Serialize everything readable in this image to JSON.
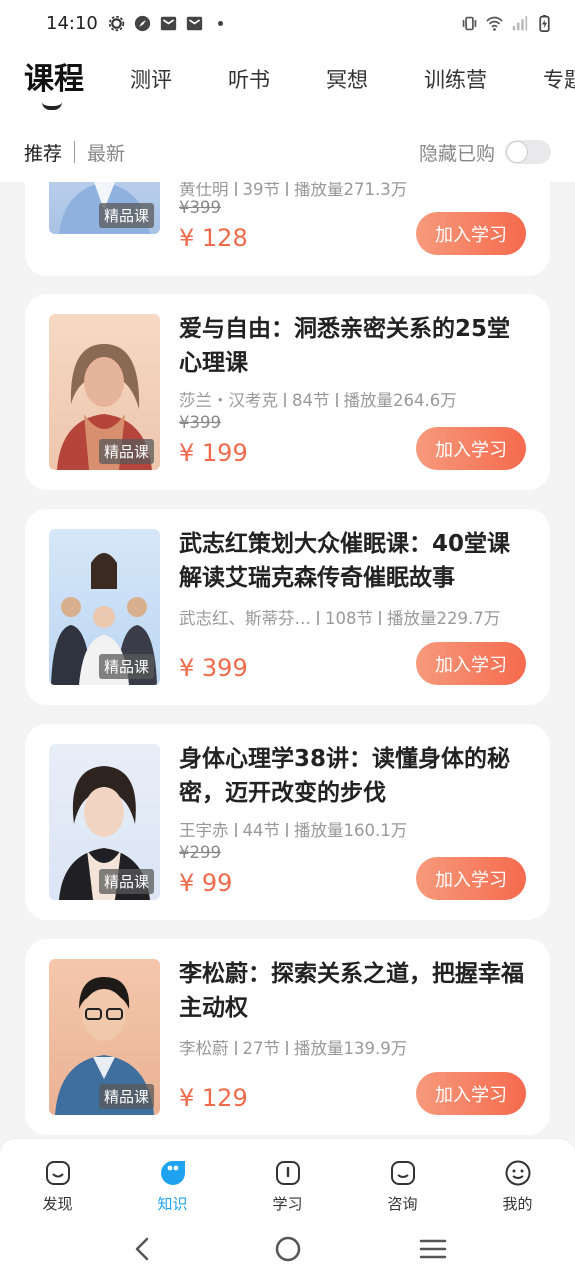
{
  "status": {
    "time": "14:10"
  },
  "header": {
    "tabs": [
      {
        "label": "课程"
      },
      {
        "label": "测评"
      },
      {
        "label": "听书"
      },
      {
        "label": "冥想"
      },
      {
        "label": "训练营"
      },
      {
        "label": "专题"
      }
    ],
    "sub_tabs": [
      {
        "label": "推荐"
      },
      {
        "label": "最新"
      }
    ],
    "hide_bought_label": "隐藏已购"
  },
  "courses": [
    {
      "title": "",
      "meta_author": "黄仕明",
      "meta_lessons": "39节",
      "meta_plays": "播放量271.3万",
      "orig_price": "¥399",
      "price": "¥ 128",
      "badge": "精品课",
      "button": "加入学习"
    },
    {
      "title": "爱与自由：洞悉亲密关系的25堂心理课",
      "meta_author": "莎兰・汉考克",
      "meta_lessons": "84节",
      "meta_plays": "播放量264.6万",
      "orig_price": "¥399",
      "price": "¥ 199",
      "badge": "精品课",
      "button": "加入学习"
    },
    {
      "title": "武志红策划大众催眠课：40堂课解读艾瑞克森传奇催眠故事",
      "meta_author": "武志红、斯蒂芬…",
      "meta_lessons": "108节",
      "meta_plays": "播放量229.7万",
      "orig_price": "",
      "price": "¥ 399",
      "badge": "精品课",
      "button": "加入学习"
    },
    {
      "title": "身体心理学38讲：读懂身体的秘密，迈开改变的步伐",
      "meta_author": "王宇赤",
      "meta_lessons": "44节",
      "meta_plays": "播放量160.1万",
      "orig_price": "¥299",
      "price": "¥ 99",
      "badge": "精品课",
      "button": "加入学习"
    },
    {
      "title": "李松蔚：探索关系之道，把握幸福主动权",
      "meta_author": "李松蔚",
      "meta_lessons": "27节",
      "meta_plays": "播放量139.9万",
      "orig_price": "",
      "price": "¥ 129",
      "badge": "精品课",
      "button": "加入学习"
    }
  ],
  "bottom_nav": [
    {
      "label": "发现"
    },
    {
      "label": "知识"
    },
    {
      "label": "学习"
    },
    {
      "label": "咨询"
    },
    {
      "label": "我的"
    }
  ],
  "colors": {
    "accent": "#f56a4e",
    "active_nav": "#1fa3f1"
  }
}
